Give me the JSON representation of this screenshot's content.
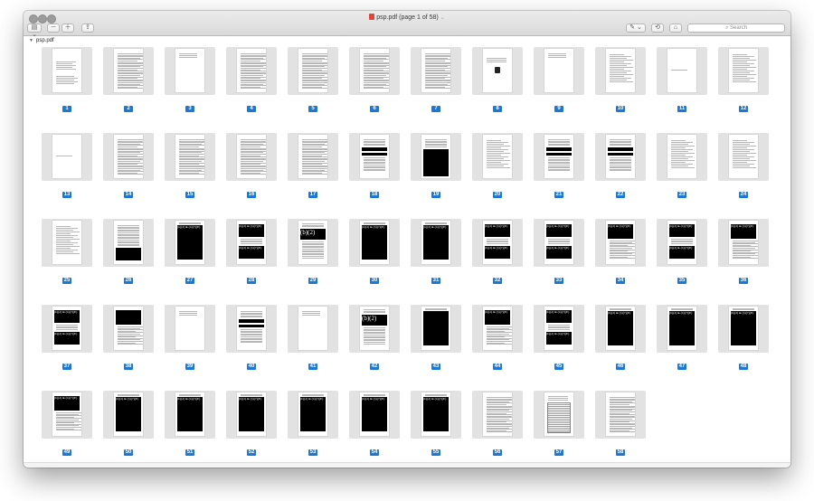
{
  "window": {
    "title": "psp.pdf (page 1 of 58)",
    "title_chevron": "⌄"
  },
  "toolbar": {
    "sidebar_label": "▤ ⌄",
    "zoom_out_label": "－",
    "zoom_in_label": "＋",
    "share_label": "⇪",
    "annotate_label": "✎ ⌄",
    "rotate_label": "⟲",
    "toolbox_label": "⌂",
    "search_placeholder": "Search"
  },
  "sidebar": {
    "document_name": "psp.pdf",
    "disclosure": "▼"
  },
  "colors": {
    "page_number_badge": "#1f77d4",
    "thumbnail_frame": "#e2e2e2"
  },
  "pages": [
    {
      "label": "1",
      "style": "cover"
    },
    {
      "label": "2",
      "style": "text"
    },
    {
      "label": "3",
      "style": "sparse"
    },
    {
      "label": "4",
      "style": "text"
    },
    {
      "label": "5",
      "style": "text"
    },
    {
      "label": "6",
      "style": "text"
    },
    {
      "label": "7",
      "style": "text"
    },
    {
      "label": "8",
      "style": "seal"
    },
    {
      "label": "9",
      "style": "sparse"
    },
    {
      "label": "10",
      "style": "list"
    },
    {
      "label": "11",
      "style": "blank"
    },
    {
      "label": "12",
      "style": "list"
    },
    {
      "label": "13",
      "style": "blank"
    },
    {
      "label": "14",
      "style": "text"
    },
    {
      "label": "15",
      "style": "text"
    },
    {
      "label": "16",
      "style": "text"
    },
    {
      "label": "17",
      "style": "text"
    },
    {
      "label": "18",
      "style": "bars"
    },
    {
      "label": "19",
      "style": "bottom-black"
    },
    {
      "label": "20",
      "style": "list"
    },
    {
      "label": "21",
      "style": "bars"
    },
    {
      "label": "22",
      "style": "bars"
    },
    {
      "label": "23",
      "style": "list"
    },
    {
      "label": "24",
      "style": "list"
    },
    {
      "label": "25",
      "style": "list"
    },
    {
      "label": "26",
      "style": "half-black"
    },
    {
      "label": "27",
      "style": "full-black",
      "redaction": "(b)(2) & (b)(7)(E)"
    },
    {
      "label": "28",
      "style": "split-black",
      "redaction": "(b)(2) & (b)(7)(E)"
    },
    {
      "label": "29",
      "style": "b2",
      "redaction": "(b)(2)"
    },
    {
      "label": "30",
      "style": "full-black",
      "redaction": "(b)(2) & (b)(7)(E)"
    },
    {
      "label": "31",
      "style": "full-black",
      "redaction": "(b)(2) & (b)(7)(E)"
    },
    {
      "label": "32",
      "style": "split-black",
      "redaction": "(b)(2) & (b)(7)(E)"
    },
    {
      "label": "33",
      "style": "split-black",
      "redaction": "(b)(2) & (b)(7)(E)"
    },
    {
      "label": "34",
      "style": "top-black",
      "redaction": "(b)(2) & (b)(7)(E)"
    },
    {
      "label": "35",
      "style": "split-black",
      "redaction": "(b)(2) & (b)(7)(E)"
    },
    {
      "label": "36",
      "style": "top-black",
      "redaction": "(b)(2) & (b)(7)(E)"
    },
    {
      "label": "37",
      "style": "split-black",
      "redaction": "(b)(2) & (b)(7)(E)"
    },
    {
      "label": "38",
      "style": "top-black",
      "redaction": ""
    },
    {
      "label": "39",
      "style": "sparse"
    },
    {
      "label": "40",
      "style": "bars"
    },
    {
      "label": "41",
      "style": "sparse"
    },
    {
      "label": "42",
      "style": "b2",
      "redaction": "(b)(2)"
    },
    {
      "label": "43",
      "style": "full-black",
      "redaction": ""
    },
    {
      "label": "44",
      "style": "top-black",
      "redaction": "(b)(2) & (b)(7)(E)"
    },
    {
      "label": "45",
      "style": "split-black",
      "redaction": "(b)(2) & (b)(7)(E)"
    },
    {
      "label": "46",
      "style": "full-black",
      "redaction": "(b)(2) & (b)(7)(E)"
    },
    {
      "label": "47",
      "style": "full-black",
      "redaction": "(b)(2) & (b)(7)(E)"
    },
    {
      "label": "48",
      "style": "full-black",
      "redaction": "(b)(2) & (b)(7)(E)"
    },
    {
      "label": "49",
      "style": "top-black",
      "redaction": "(b)(2) & (b)(7)(E)"
    },
    {
      "label": "50",
      "style": "full-black",
      "redaction": "(b)(2) & (b)(7)(E)"
    },
    {
      "label": "51",
      "style": "full-black",
      "redaction": "(b)(2) & (b)(7)(E)"
    },
    {
      "label": "52",
      "style": "full-black",
      "redaction": "(b)(2) & (b)(7)(E)"
    },
    {
      "label": "53",
      "style": "full-black",
      "redaction": "(b)(2) & (b)(7)(E)"
    },
    {
      "label": "54",
      "style": "full-black",
      "redaction": "(b)(2) & (b)(7)(E)"
    },
    {
      "label": "55",
      "style": "full-black",
      "redaction": "(b)(2) & (b)(7)(E)"
    },
    {
      "label": "56",
      "style": "text"
    },
    {
      "label": "57",
      "style": "table"
    },
    {
      "label": "58",
      "style": "text"
    }
  ]
}
